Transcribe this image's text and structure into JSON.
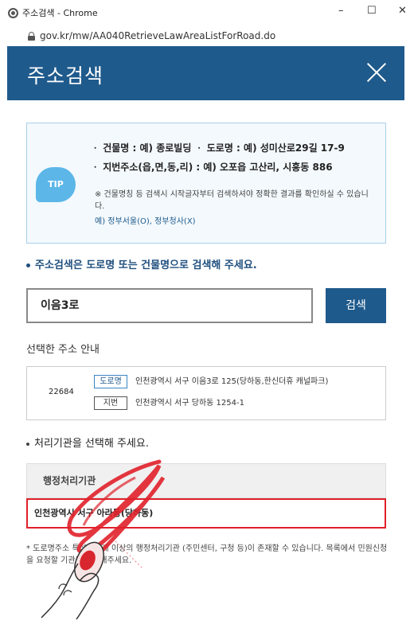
{
  "browser": {
    "window_title": "주소검색 - Chrome",
    "minimize": "–",
    "maximize": "☐",
    "close": "✕",
    "url": "gov.kr/mw/AA040RetrieveLawAreaListForRoad.do"
  },
  "header": {
    "title": "주소검색"
  },
  "tip": {
    "badge": "TIP",
    "line1": "ㆍ 건물명 : 예) 종로빌딩   ㆍ 도로명 : 예) 성미산로29길 17-9",
    "line2": "ㆍ 지번주소(읍,면,동,리) : 예) 오포읍 고산리, 시흥동 886",
    "note": "※ 건물명칭 등 검색시 시작글자부터 검색하셔야 정확한 결과를 확인하실 수 있습니다.",
    "example": "예) 정부서울(O), 정부청사(X)"
  },
  "guide_text": "주소검색은 도로명 또는 건물명으로 검색해 주세요.",
  "search": {
    "value": "이음3로",
    "button": "검색"
  },
  "selected_label": "선택한 주소 안내",
  "address": {
    "zipcode": "22684",
    "road_tag": "도로명",
    "road_address": "인천광역시 서구 이음3로 125(당하동,한신더휴 캐널파크)",
    "jibun_tag": "지번",
    "jibun_address": "인천광역시 서구 당하동 1254-1"
  },
  "agency": {
    "prompt": "처리기관을 선택해 주세요.",
    "header": "행정처리기관",
    "selected": "인천광역시 서구 아라동(당하동)"
  },
  "footnote": "* 도로명주소 특성상 1개 이상의 행정처리기관 (주민센터, 구청 등)이 존재할 수 있습니다. 목록에서 민원신청을 요청할 기관을 선택해주세요.",
  "colors": {
    "primary": "#1f5a8c",
    "highlight": "#e0202a",
    "tip_badge": "#5cb6e8"
  }
}
